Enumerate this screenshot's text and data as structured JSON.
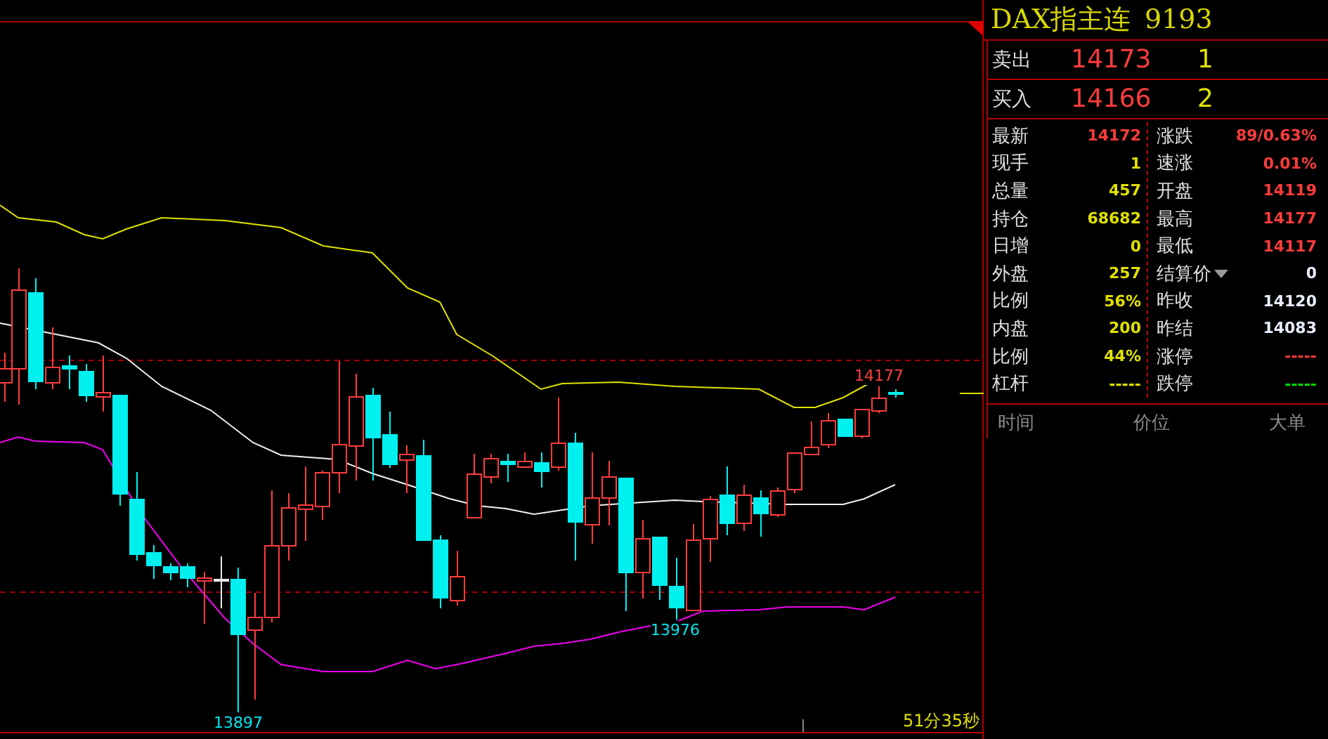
{
  "title": {
    "name": "DAX指主连",
    "code": "9193"
  },
  "quotes": [
    {
      "label": "卖出",
      "price": "14173",
      "volume": "1"
    },
    {
      "label": "买入",
      "price": "14166",
      "volume": "2"
    }
  ],
  "stats_left": [
    {
      "label": "最新",
      "value": "14172",
      "color": "#ff3c3c"
    },
    {
      "label": "现手",
      "value": "1",
      "color": "#e0e000"
    },
    {
      "label": "总量",
      "value": "457",
      "color": "#e0e000"
    },
    {
      "label": "持仓",
      "value": "68682",
      "color": "#e0e000"
    },
    {
      "label": "日增",
      "value": "0",
      "color": "#e0e000"
    },
    {
      "label": "外盘",
      "value": "257",
      "color": "#e0e000"
    },
    {
      "label": "比例",
      "value": "56%",
      "color": "#e0e000"
    },
    {
      "label": "内盘",
      "value": "200",
      "color": "#e0e000"
    },
    {
      "label": "比例",
      "value": "44%",
      "color": "#e0e000"
    },
    {
      "label": "杠杆",
      "value": "-----",
      "color": "#e0e000"
    }
  ],
  "stats_right": [
    {
      "label": "涨跌",
      "value": "89/0.63%",
      "color": "#ff3c3c",
      "kind": "plain"
    },
    {
      "label": "速涨",
      "value": "0.01%",
      "color": "#ff3c3c",
      "kind": "plain"
    },
    {
      "label": "开盘",
      "value": "14119",
      "color": "#ff3c3c",
      "kind": "plain"
    },
    {
      "label": "最高",
      "value": "14177",
      "color": "#ff3c3c",
      "kind": "plain"
    },
    {
      "label": "最低",
      "value": "14117",
      "color": "#ff3c3c",
      "kind": "plain"
    },
    {
      "label": "结算价",
      "value": "0",
      "color": "#e8eeff",
      "kind": "dropdown"
    },
    {
      "label": "昨收",
      "value": "14120",
      "color": "#e8eeff",
      "kind": "plain"
    },
    {
      "label": "昨结",
      "value": "14083",
      "color": "#e8eeff",
      "kind": "plain"
    },
    {
      "label": "涨停",
      "value": "-----",
      "color": "#ff3c3c",
      "kind": "plain"
    },
    {
      "label": "跌停",
      "value": "-----",
      "color": "#00e000",
      "kind": "plain"
    }
  ],
  "ticks_header": [
    "时间",
    "价位",
    "大单"
  ],
  "chart": {
    "labels": [
      {
        "text": "14177",
        "kind": "high"
      },
      {
        "text": "13976",
        "kind": "low"
      },
      {
        "text": "13897",
        "kind": "low"
      }
    ],
    "timer": "51分35秒"
  }
}
